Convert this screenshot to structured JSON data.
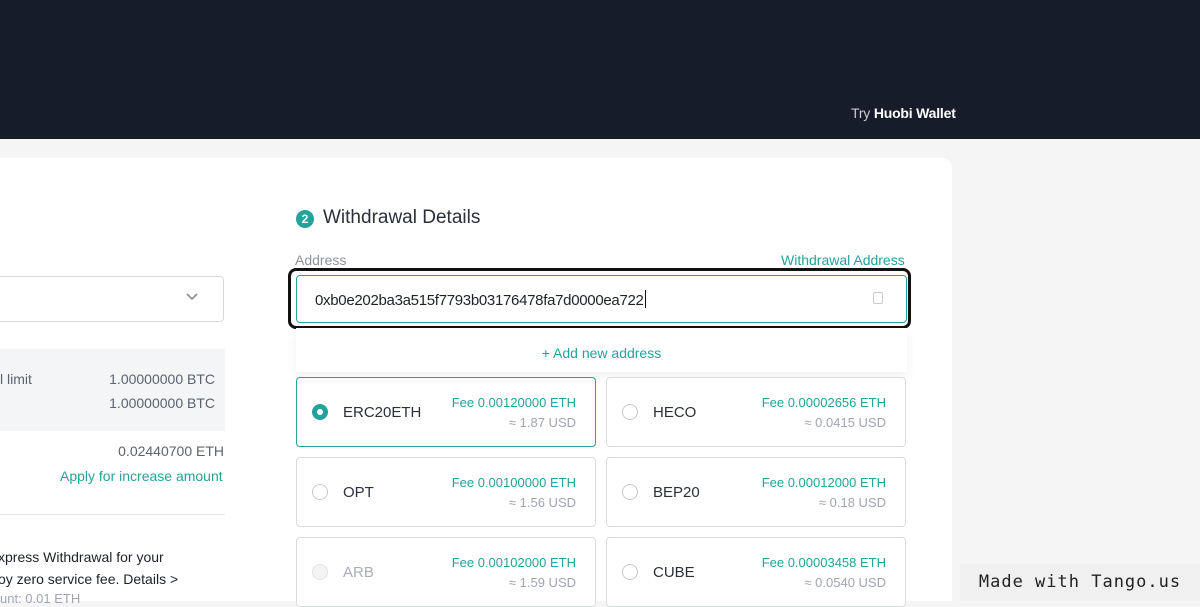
{
  "header": {
    "try_prefix": "Try",
    "wallet_label": "Huobi Wallet"
  },
  "left": {
    "limit_label": "l limit",
    "limit_value": "1.00000000 BTC",
    "limit_value_2": "1.00000000 BTC",
    "eth_amount": "0.02440700 ETH",
    "apply_link": "Apply for increase amount",
    "express_line1": "xpress Withdrawal for your",
    "express_line2": "oy zero service fee. Details >",
    "min_amount": "unt: 0.01 ETH"
  },
  "withdrawal": {
    "step": "2",
    "title": "Withdrawal Details",
    "address_label": "Address",
    "address_link": "Withdrawal Address",
    "address_value": "0xb0e202ba3a515f7793b03176478fa7d0000ea722",
    "add_new": "+ Add new address"
  },
  "networks": [
    {
      "name": "ERC20ETH",
      "fee": "Fee 0.00120000 ETH",
      "usd": "≈ 1.87 USD",
      "selected": true,
      "disabled": false
    },
    {
      "name": "HECO",
      "fee": "Fee 0.00002656 ETH",
      "usd": "≈ 0.0415 USD",
      "selected": false,
      "disabled": false
    },
    {
      "name": "OPT",
      "fee": "Fee 0.00100000 ETH",
      "usd": "≈ 1.56 USD",
      "selected": false,
      "disabled": false
    },
    {
      "name": "BEP20",
      "fee": "Fee 0.00012000 ETH",
      "usd": "≈ 0.18 USD",
      "selected": false,
      "disabled": false
    },
    {
      "name": "ARB",
      "fee": "Fee 0.00102000 ETH",
      "usd": "≈ 1.59 USD",
      "selected": false,
      "disabled": true
    },
    {
      "name": "CUBE",
      "fee": "Fee 0.00003458 ETH",
      "usd": "≈ 0.0540 USD",
      "selected": false,
      "disabled": false
    }
  ],
  "watermark": "Made with Tango.us",
  "colors": {
    "accent": "#25a29b",
    "header_bg": "#171c2a"
  }
}
